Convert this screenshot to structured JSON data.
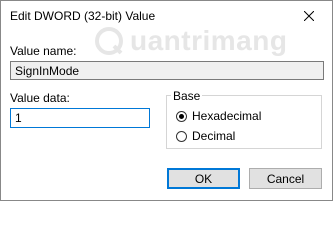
{
  "window": {
    "title": "Edit DWORD (32-bit) Value"
  },
  "watermark": {
    "text": "uantrimang"
  },
  "value_name": {
    "label": "Value name:",
    "value": "SignInMode"
  },
  "value_data": {
    "label": "Value data:",
    "value": "1"
  },
  "base": {
    "legend": "Base",
    "options": [
      {
        "label": "Hexadecimal",
        "selected": true
      },
      {
        "label": "Decimal",
        "selected": false
      }
    ]
  },
  "buttons": {
    "ok": "OK",
    "cancel": "Cancel"
  }
}
